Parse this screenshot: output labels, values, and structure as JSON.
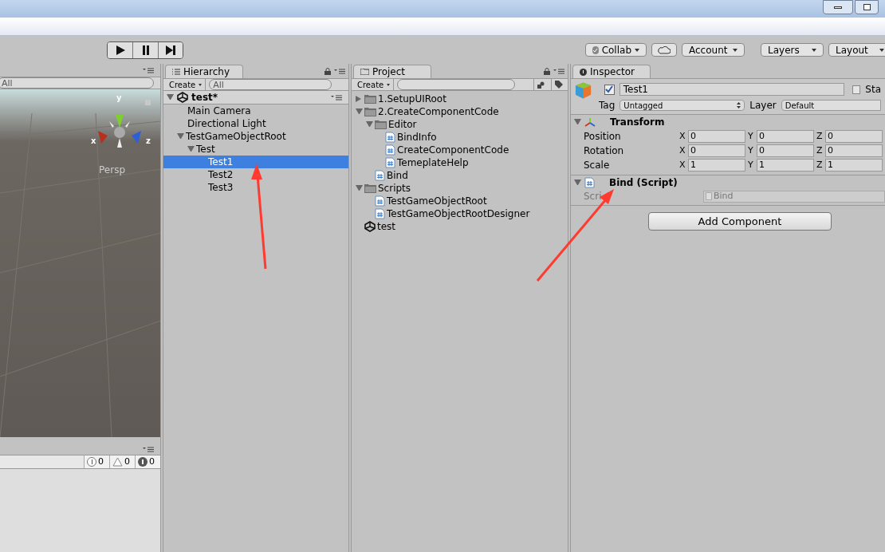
{
  "toolbar": {
    "buttons": [
      {
        "label": "Collab",
        "kind": "dropdown-check"
      },
      {
        "kind": "cloud"
      },
      {
        "label": "Account",
        "kind": "dropdown"
      },
      {
        "label": "Layers",
        "kind": "dropdown"
      },
      {
        "label": "Layout",
        "kind": "dropdown"
      }
    ]
  },
  "scene": {
    "search": {
      "placeholder": "All"
    },
    "gizmo": {
      "y": "y",
      "x": "x",
      "z": "z"
    },
    "view": "Persp"
  },
  "console": {
    "counts": [
      {
        "kind": "info",
        "count": "0"
      },
      {
        "kind": "warning",
        "count": "0"
      },
      {
        "kind": "error",
        "count": "0"
      }
    ]
  },
  "hierarchy": {
    "tab": "Hierarchy",
    "create": "Create",
    "search": {
      "placeholder": "All"
    },
    "scene": "test*",
    "items": [
      {
        "label": "Main Camera",
        "selected": false
      },
      {
        "label": "Directional Light",
        "selected": false
      },
      {
        "label": "TestGameObjectRoot",
        "selected": false,
        "expanded": true,
        "children": [
          {
            "label": "Test",
            "selected": false,
            "expanded": true,
            "children": [
              {
                "label": "Test1",
                "selected": true
              },
              {
                "label": "Test2",
                "selected": false
              },
              {
                "label": "Test3",
                "selected": false
              }
            ]
          }
        ]
      }
    ]
  },
  "project": {
    "tab": "Project",
    "create": "Create",
    "items": [
      {
        "label": "1.SetupUIRoot",
        "kind": "folder",
        "expanded": false
      },
      {
        "label": "2.CreateComponentCode",
        "kind": "folder",
        "expanded": true,
        "children": [
          {
            "label": "Editor",
            "kind": "folder",
            "expanded": true,
            "children": [
              {
                "label": "BindInfo",
                "kind": "script"
              },
              {
                "label": "CreateComponentCode",
                "kind": "script"
              },
              {
                "label": "TemeplateHelp",
                "kind": "script"
              }
            ]
          },
          {
            "label": "Bind",
            "kind": "script"
          }
        ]
      },
      {
        "label": "Scripts",
        "kind": "folder",
        "expanded": true,
        "children": [
          {
            "label": "TestGameObjectRoot",
            "kind": "script"
          },
          {
            "label": "TestGameObjectRootDesigner",
            "kind": "script"
          }
        ]
      },
      {
        "label": "test",
        "kind": "scene"
      }
    ]
  },
  "inspector": {
    "tab": "Inspector",
    "active": true,
    "name": "Test1",
    "static_label": "Sta",
    "static": false,
    "tag_label": "Tag",
    "tag": "Untagged",
    "layer_label": "Layer",
    "layer": "Default",
    "components": [
      {
        "kind": "transform",
        "title": "Transform",
        "expanded": true,
        "rows": [
          {
            "label": "Position",
            "fields": [
              {
                "axis": "X",
                "value": "0"
              },
              {
                "axis": "Y",
                "value": "0"
              },
              {
                "axis": "Z",
                "value": "0"
              }
            ]
          },
          {
            "label": "Rotation",
            "fields": [
              {
                "axis": "X",
                "value": "0"
              },
              {
                "axis": "Y",
                "value": "0"
              },
              {
                "axis": "Z",
                "value": "0"
              }
            ]
          },
          {
            "label": "Scale",
            "fields": [
              {
                "axis": "X",
                "value": "1"
              },
              {
                "axis": "Y",
                "value": "1"
              },
              {
                "axis": "Z",
                "value": "1"
              }
            ]
          }
        ]
      },
      {
        "kind": "script",
        "title": "Bind (Script)",
        "expanded": true,
        "field_label": "Scri",
        "value": "Bind",
        "disabled": true
      }
    ],
    "add_button": "Add Component"
  }
}
